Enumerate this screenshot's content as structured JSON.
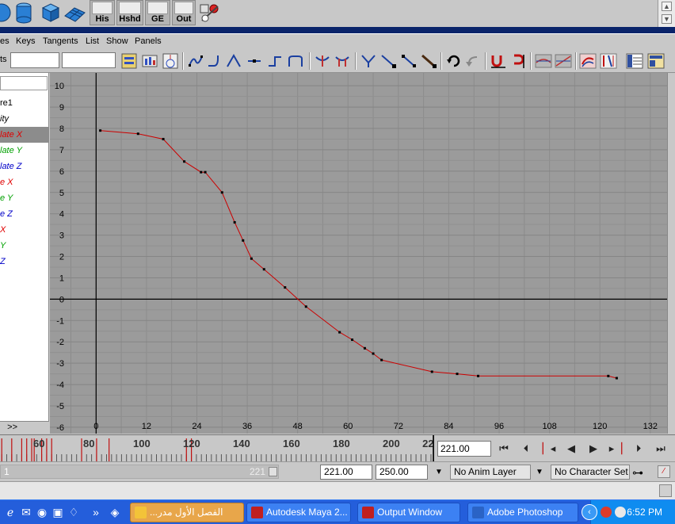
{
  "shelf": {
    "buttons": [
      {
        "label": "His"
      },
      {
        "label": "Hshd"
      },
      {
        "label": "GE"
      },
      {
        "label": "Out"
      }
    ]
  },
  "menubar": {
    "items": [
      "es",
      "Keys",
      "Tangents",
      "List",
      "Show",
      "Panels"
    ]
  },
  "toolbar": {
    "stats_label": "ts",
    "frame_field": "",
    "value_field": ""
  },
  "outliner": {
    "items": [
      {
        "label": "re1",
        "color": "#000000"
      },
      {
        "label": "ity",
        "color": "#000000"
      },
      {
        "label": "late X",
        "color": "#e00000",
        "selected": true
      },
      {
        "label": "late Y",
        "color": "#00a000"
      },
      {
        "label": "late Z",
        "color": "#0000c8"
      },
      {
        "label": "e X",
        "color": "#e00000"
      },
      {
        "label": "e Y",
        "color": "#00a000"
      },
      {
        "label": "e Z",
        "color": "#0000c8"
      },
      {
        "label": "X",
        "color": "#e00000"
      },
      {
        "label": "Y",
        "color": "#00a000"
      },
      {
        "label": "Z",
        "color": "#0000c8"
      }
    ],
    "bottom_label": ">>"
  },
  "chart_data": {
    "type": "line",
    "x_ticks": [
      0,
      12,
      24,
      36,
      48,
      60,
      72,
      84,
      96,
      108,
      120,
      132
    ],
    "y_ticks": [
      10,
      9,
      8,
      7,
      6,
      5,
      4,
      3,
      2,
      1,
      0,
      -1,
      -2,
      -3,
      -4,
      -5,
      -6
    ],
    "xlim": [
      -11,
      136
    ],
    "ylim": [
      -6.3,
      10.6
    ],
    "series": [
      {
        "color": "#cc0000",
        "points": [
          [
            1,
            7.9
          ],
          [
            10,
            7.75
          ],
          [
            16,
            7.5
          ],
          [
            21,
            6.45
          ],
          [
            25,
            5.95
          ],
          [
            26,
            5.95
          ],
          [
            30,
            5.0
          ],
          [
            33,
            3.6
          ],
          [
            35,
            2.75
          ],
          [
            37,
            1.9
          ],
          [
            40,
            1.4
          ],
          [
            45,
            0.55
          ],
          [
            50,
            -0.35
          ],
          [
            58,
            -1.55
          ],
          [
            61,
            -1.9
          ],
          [
            64,
            -2.3
          ],
          [
            66,
            -2.55
          ],
          [
            68,
            -2.85
          ],
          [
            80,
            -3.4
          ],
          [
            86,
            -3.5
          ],
          [
            91,
            -3.6
          ],
          [
            122,
            -3.6
          ],
          [
            124,
            -3.7
          ]
        ]
      }
    ],
    "grid": true,
    "background": "#9b9b9b"
  },
  "timeslider": {
    "labels": [
      "60",
      "80",
      "100",
      "120",
      "140",
      "160",
      "180",
      "200",
      "22"
    ],
    "current_time": "221.00"
  },
  "playback": {
    "buttons": [
      "go-start",
      "step-back-key",
      "step-back",
      "play-back",
      "play-forward",
      "step-forward",
      "step-forward-key",
      "go-end"
    ]
  },
  "rangeslider": {
    "left_value": "1",
    "handle_value": "221",
    "playback_end": "221.00",
    "animation_end": "250.00",
    "anim_layer": "No Anim Layer",
    "character_set": "No Character Set"
  },
  "taskbar": {
    "tasks": [
      {
        "label": "...الفصل الأول  مدر",
        "active": true,
        "icon_color": "#f3c338"
      },
      {
        "label": "Autodesk Maya 2...",
        "active": false,
        "icon_color": "#c02020"
      },
      {
        "label": "Output Window",
        "active": false,
        "icon_color": "#c02020"
      },
      {
        "label": "Adobe Photoshop",
        "active": false,
        "icon_color": "#2a63c6"
      }
    ],
    "clock": "6:52 PM"
  }
}
